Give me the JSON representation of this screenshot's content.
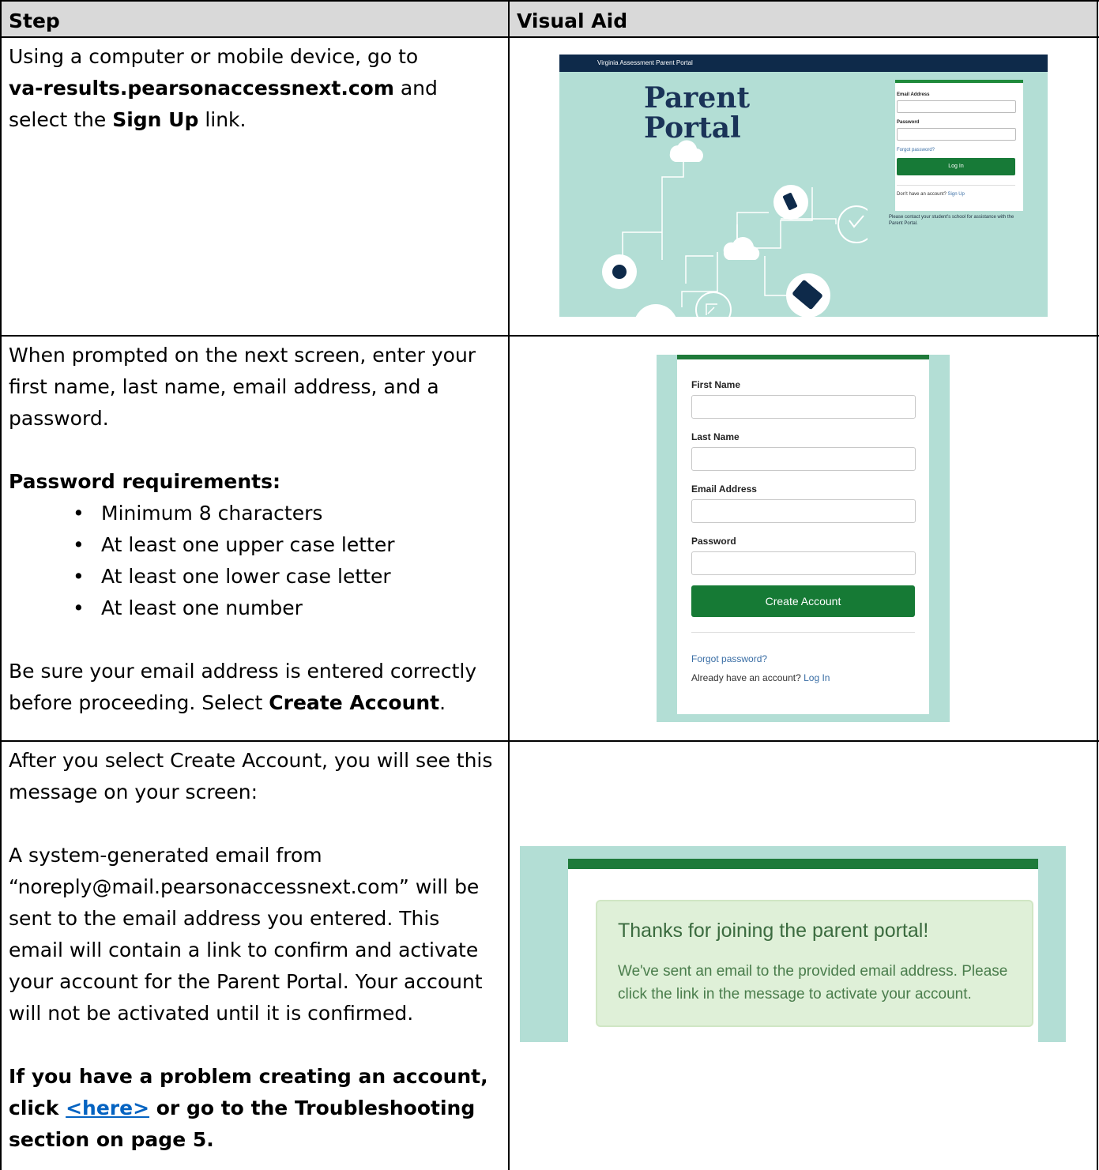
{
  "table": {
    "headers": {
      "step": "Step",
      "visual_aid": "Visual Aid"
    },
    "row1": {
      "text_a": "Using a computer or mobile device, go to",
      "url": "va-results.pearsonaccessnext.com",
      "text_b": " and select the ",
      "link_name": "Sign Up",
      "text_c": " link."
    },
    "row2": {
      "intro": "When prompted on the next screen, enter your first name, last name, email address, and a password.",
      "req_heading": "Password requirements:",
      "requirements": [
        "Minimum 8 characters",
        "At least one upper case letter",
        "At least one lower case letter",
        "At least one number"
      ],
      "closing_a": "Be sure your email address is entered correctly before proceeding. Select ",
      "closing_bold": "Create Account",
      "closing_b": "."
    },
    "row3": {
      "intro": "After you select Create Account, you will see this message on your screen:",
      "body": "A system-generated email from “noreply@mail.pearsonaccessnext.com” will be sent to the email address you entered. This email will contain a link to confirm and activate your account for the Parent Portal. Your account will not be activated until it is confirmed.",
      "problem_a": "If you have a problem creating an account, click ",
      "problem_link": "<here>",
      "problem_b": " or go to the Troubleshooting section on page 5."
    }
  },
  "visual_aid_1": {
    "header_bar": "Virginia Assessment Parent Portal",
    "title_line1": "Parent",
    "title_line2": "Portal",
    "email_label": "Email Address",
    "password_label": "Password",
    "forgot": "Forgot password?",
    "login_button": "Log In",
    "no_account": "Don't have an account? ",
    "sign_up": "Sign Up",
    "contact": "Please contact your student's school for assistance with the Parent Portal.",
    "colors": {
      "background": "#b3ded5",
      "header": "#0e2a4a",
      "accent": "#177a37",
      "title": "#1a3358"
    }
  },
  "visual_aid_2": {
    "first_name": "First Name",
    "last_name": "Last Name",
    "email": "Email Address",
    "password": "Password",
    "create_button": "Create Account",
    "forgot": "Forgot password?",
    "already": "Already have an account? ",
    "login_link": "Log In"
  },
  "visual_aid_3": {
    "heading": "Thanks for joining the parent portal!",
    "text": "We've sent an email to the provided email address. Please click the link in the message to activate your account."
  }
}
